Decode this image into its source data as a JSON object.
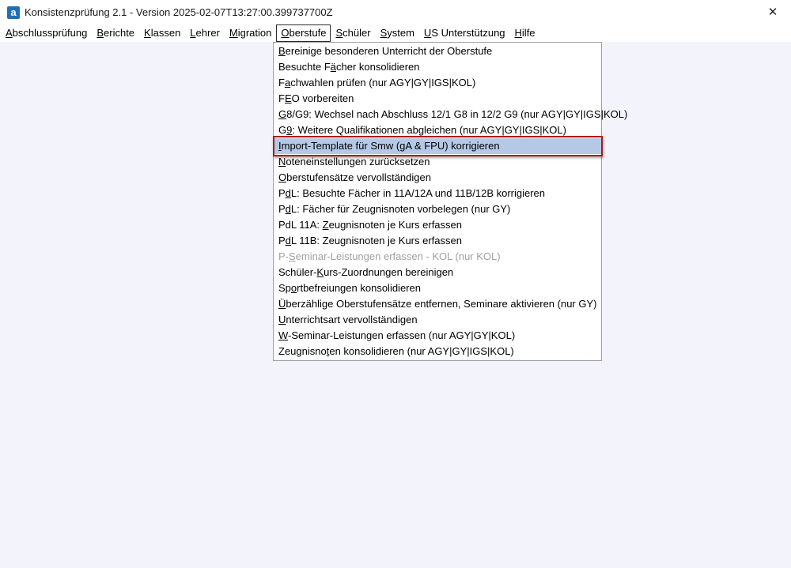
{
  "window": {
    "title": "Konsistenzprüfung 2.1 - Version 2025-02-07T13:27:00.399737700Z",
    "app_icon_glyph": "a",
    "app_icon": "app-logo-icon",
    "close_glyph": "✕",
    "close_icon": "close-icon"
  },
  "colors": {
    "client_background": "#f3f3fb",
    "highlight_background": "#b5c9e6",
    "highlight_outline": "#b01818",
    "disabled_text": "#a0a0a0"
  },
  "menubar": {
    "open_index": 5,
    "items": [
      {
        "pre": "",
        "key": "A",
        "post": "bschlussprüfung"
      },
      {
        "pre": "",
        "key": "B",
        "post": "erichte"
      },
      {
        "pre": "",
        "key": "K",
        "post": "lassen"
      },
      {
        "pre": "",
        "key": "L",
        "post": "ehrer"
      },
      {
        "pre": "",
        "key": "M",
        "post": "igration"
      },
      {
        "pre": "",
        "key": "O",
        "post": "berstufe"
      },
      {
        "pre": "",
        "key": "S",
        "post": "chüler"
      },
      {
        "pre": "",
        "key": "S",
        "post": "ystem"
      },
      {
        "pre": "",
        "key": "U",
        "post": "S Unterstützung"
      },
      {
        "pre": "",
        "key": "H",
        "post": "ilfe"
      }
    ]
  },
  "menu_oberstufe": {
    "items": [
      {
        "pre": "",
        "key": "B",
        "post": "ereinige besonderen Unterricht der Oberstufe",
        "disabled": false,
        "highlighted": false
      },
      {
        "pre": "Besuchte F",
        "key": "ä",
        "post": "cher konsolidieren",
        "disabled": false,
        "highlighted": false
      },
      {
        "pre": "F",
        "key": "a",
        "post": "chwahlen prüfen (nur AGY|GY|IGS|KOL)",
        "disabled": false,
        "highlighted": false
      },
      {
        "pre": "F",
        "key": "E",
        "post": "O vorbereiten",
        "disabled": false,
        "highlighted": false
      },
      {
        "pre": "",
        "key": "G",
        "post": "8/G9: Wechsel nach Abschluss 12/1 G8 in 12/2 G9 (nur AGY|GY|IGS|KOL)",
        "disabled": false,
        "highlighted": false
      },
      {
        "pre": "G",
        "key": "9",
        "post": ": Weitere Qualifikationen abgleichen (nur AGY|GY|IGS|KOL)",
        "disabled": false,
        "highlighted": false
      },
      {
        "pre": "",
        "key": "I",
        "post": "mport-Template für Smw (gA & FPU) korrigieren",
        "disabled": false,
        "highlighted": true
      },
      {
        "pre": "",
        "key": "N",
        "post": "oteneinstellungen zurücksetzen",
        "disabled": false,
        "highlighted": false
      },
      {
        "pre": "",
        "key": "O",
        "post": "berstufensätze vervollständigen",
        "disabled": false,
        "highlighted": false
      },
      {
        "pre": "P",
        "key": "d",
        "post": "L: Besuchte Fächer in 11A/12A und 11B/12B korrigieren",
        "disabled": false,
        "highlighted": false
      },
      {
        "pre": "P",
        "key": "d",
        "post": "L: Fächer für Zeugnisnoten vorbelegen (nur GY)",
        "disabled": false,
        "highlighted": false
      },
      {
        "pre": "PdL 11A: ",
        "key": "Z",
        "post": "eugnisnoten je Kurs erfassen",
        "disabled": false,
        "highlighted": false
      },
      {
        "pre": "P",
        "key": "d",
        "post": "L 11B: Zeugnisnoten je Kurs erfassen",
        "disabled": false,
        "highlighted": false
      },
      {
        "pre": "P-",
        "key": "S",
        "post": "eminar-Leistungen erfassen - KOL (nur KOL)",
        "disabled": true,
        "highlighted": false
      },
      {
        "pre": "Schüler-",
        "key": "K",
        "post": "urs-Zuordnungen bereinigen",
        "disabled": false,
        "highlighted": false
      },
      {
        "pre": "Sp",
        "key": "o",
        "post": "rtbefreiungen konsolidieren",
        "disabled": false,
        "highlighted": false
      },
      {
        "pre": "",
        "key": "Ü",
        "post": "berzählige Oberstufensätze entfernen, Seminare aktivieren (nur GY)",
        "disabled": false,
        "highlighted": false
      },
      {
        "pre": "",
        "key": "U",
        "post": "nterrichtsart vervollständigen",
        "disabled": false,
        "highlighted": false
      },
      {
        "pre": "",
        "key": "W",
        "post": "-Seminar-Leistungen erfassen (nur AGY|GY|KOL)",
        "disabled": false,
        "highlighted": false
      },
      {
        "pre": "Zeugnisno",
        "key": "t",
        "post": "en konsolidieren (nur AGY|GY|IGS|KOL)",
        "disabled": false,
        "highlighted": false
      }
    ]
  }
}
